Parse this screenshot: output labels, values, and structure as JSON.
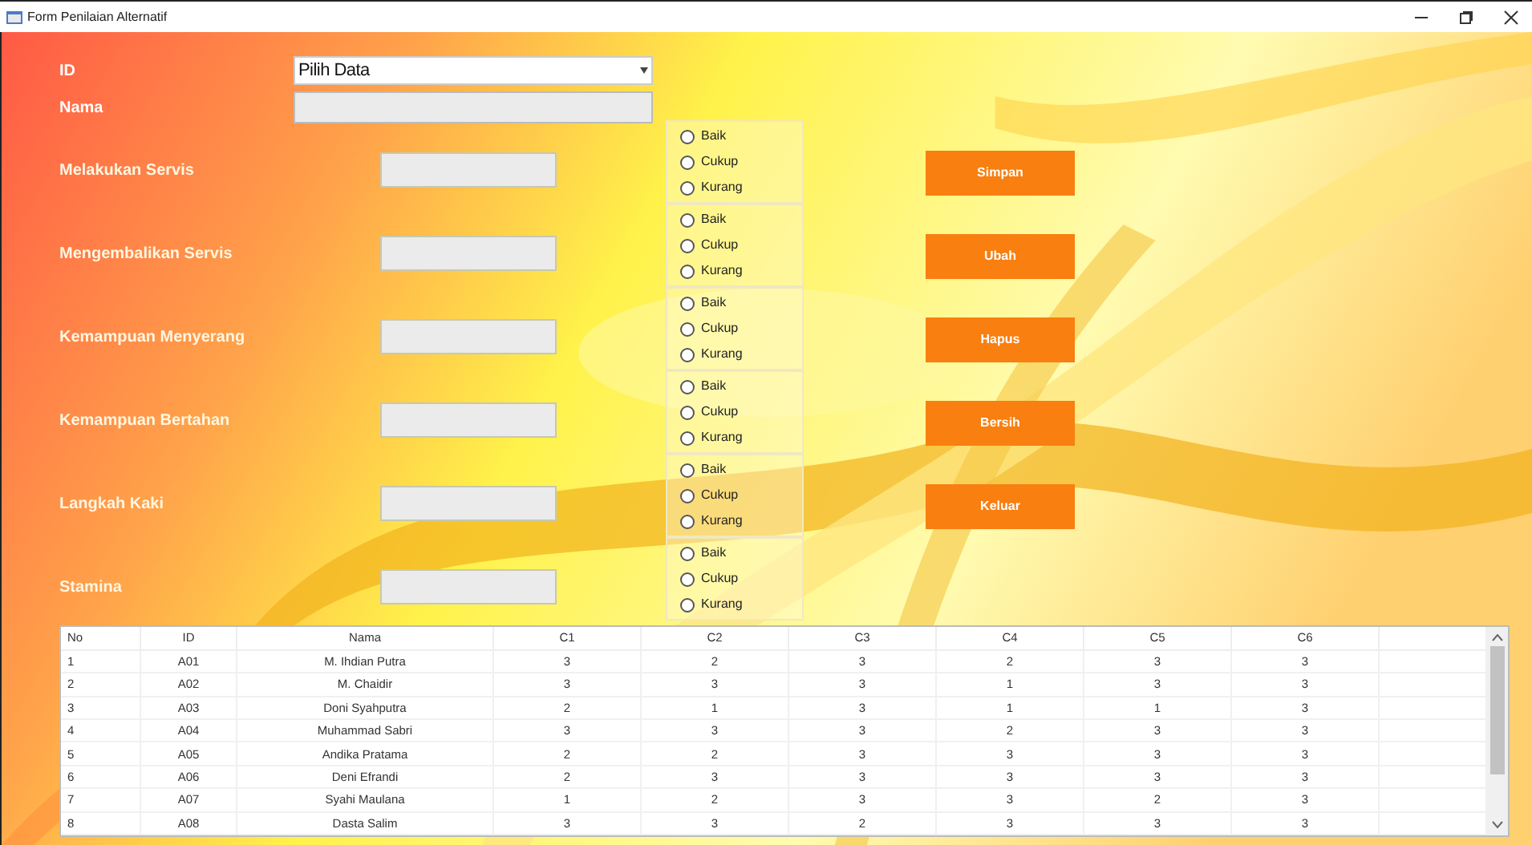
{
  "window": {
    "title": "Form Penilaian Alternatif"
  },
  "id_field": {
    "label": "ID",
    "value": "Pilih Data"
  },
  "nama_field": {
    "label": "Nama"
  },
  "criteria": [
    {
      "label": "Melakukan Servis",
      "options": [
        {
          "label": "Baik",
          "selected": false
        },
        {
          "label": "Cukup",
          "selected": false
        },
        {
          "label": "Kurang",
          "selected": false
        }
      ]
    },
    {
      "label": "Mengembalikan Servis",
      "options": [
        {
          "label": "Baik",
          "selected": false
        },
        {
          "label": "Cukup",
          "selected": false
        },
        {
          "label": "Kurang",
          "selected": false
        }
      ]
    },
    {
      "label": "Kemampuan Menyerang",
      "options": [
        {
          "label": "Baik",
          "selected": false
        },
        {
          "label": "Cukup",
          "selected": false
        },
        {
          "label": "Kurang",
          "selected": false
        }
      ]
    },
    {
      "label": "Kemampuan Bertahan",
      "options": [
        {
          "label": "Baik",
          "selected": false
        },
        {
          "label": "Cukup",
          "selected": false
        },
        {
          "label": "Kurang",
          "selected": false
        }
      ]
    },
    {
      "label": "Langkah Kaki",
      "options": [
        {
          "label": "Baik",
          "selected": false
        },
        {
          "label": "Cukup",
          "selected": false
        },
        {
          "label": "Kurang",
          "selected": false
        }
      ]
    },
    {
      "label": "Stamina",
      "options": [
        {
          "label": "Baik",
          "selected": false
        },
        {
          "label": "Cukup",
          "selected": false
        },
        {
          "label": "Kurang",
          "selected": false
        }
      ]
    }
  ],
  "buttons": [
    "Simpan",
    "Ubah",
    "Hapus",
    "Bersih",
    "Keluar"
  ],
  "table": {
    "columns": [
      "No",
      "ID",
      "Nama",
      "C1",
      "C2",
      "C3",
      "C4",
      "C5",
      "C6"
    ],
    "rows": [
      [
        "1",
        "A01",
        "M. Ihdian Putra",
        "3",
        "2",
        "3",
        "2",
        "3",
        "3"
      ],
      [
        "2",
        "A02",
        "M. Chaidir",
        "3",
        "3",
        "3",
        "1",
        "3",
        "3"
      ],
      [
        "3",
        "A03",
        "Doni Syahputra",
        "2",
        "1",
        "3",
        "1",
        "1",
        "3"
      ],
      [
        "4",
        "A04",
        "Muhammad Sabri",
        "3",
        "3",
        "3",
        "2",
        "3",
        "3"
      ],
      [
        "5",
        "A05",
        "Andika Pratama",
        "2",
        "2",
        "3",
        "3",
        "3",
        "3"
      ],
      [
        "6",
        "A06",
        "Deni Efrandi",
        "2",
        "3",
        "3",
        "3",
        "3",
        "3"
      ],
      [
        "7",
        "A07",
        "Syahi Maulana",
        "1",
        "2",
        "3",
        "3",
        "2",
        "3"
      ],
      [
        "8",
        "A08",
        "Dasta Salim",
        "3",
        "3",
        "2",
        "3",
        "3",
        "3"
      ]
    ]
  }
}
